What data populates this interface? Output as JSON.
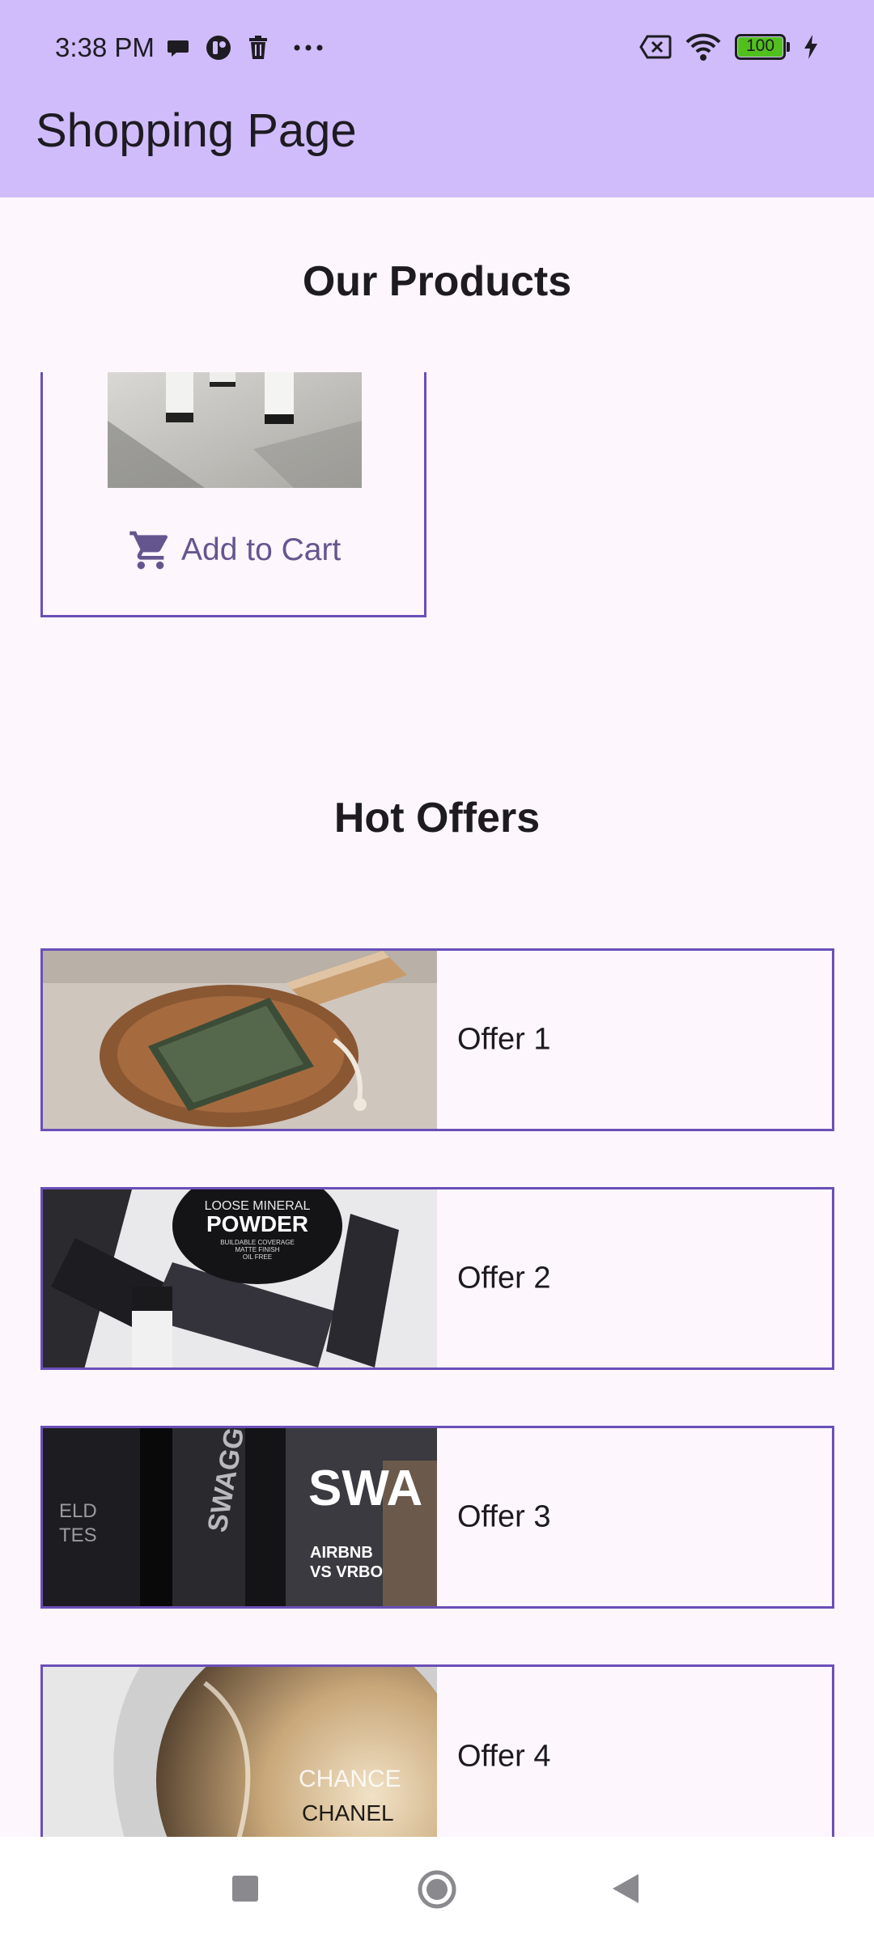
{
  "status_bar": {
    "time": "3:38 PM",
    "battery_level": "100",
    "left_icons": [
      "chat-bubble-icon",
      "app-icon",
      "trash-icon",
      "more-dots-icon"
    ],
    "right_icons": [
      "no-sim-icon",
      "wifi-icon",
      "battery-icon",
      "charging-bolt-icon"
    ]
  },
  "app_bar": {
    "title": "Shopping Page",
    "color": "#d0bcfb"
  },
  "products": {
    "title": "Our Products",
    "add_to_cart_label": "Add to Cart",
    "accent_color": "#65558f"
  },
  "offers": {
    "title": "Hot Offers",
    "items": [
      {
        "label": "Offer 1",
        "image": "soap-photo"
      },
      {
        "label": "Offer 2",
        "image": "cosmetics-photo",
        "image_text": [
          "LOOSE MINERAL",
          "POWDER",
          "BUILDABLE COVERAGE",
          "MATTE FINISH",
          "OIL FREE"
        ]
      },
      {
        "label": "Offer 3",
        "image": "grooming-products-photo",
        "image_text": [
          "SWAGG",
          "SWA",
          "AIRBNB",
          "VS VRBO",
          "ELD",
          "TES"
        ]
      },
      {
        "label": "Offer 4",
        "image": "perfume-photo",
        "image_text": [
          "CHANCE",
          "CHANEL"
        ]
      }
    ],
    "border_color": "#6b4fb8"
  },
  "nav_bar": {
    "buttons": [
      "recents-square-icon",
      "home-circle-icon",
      "back-triangle-icon"
    ]
  }
}
